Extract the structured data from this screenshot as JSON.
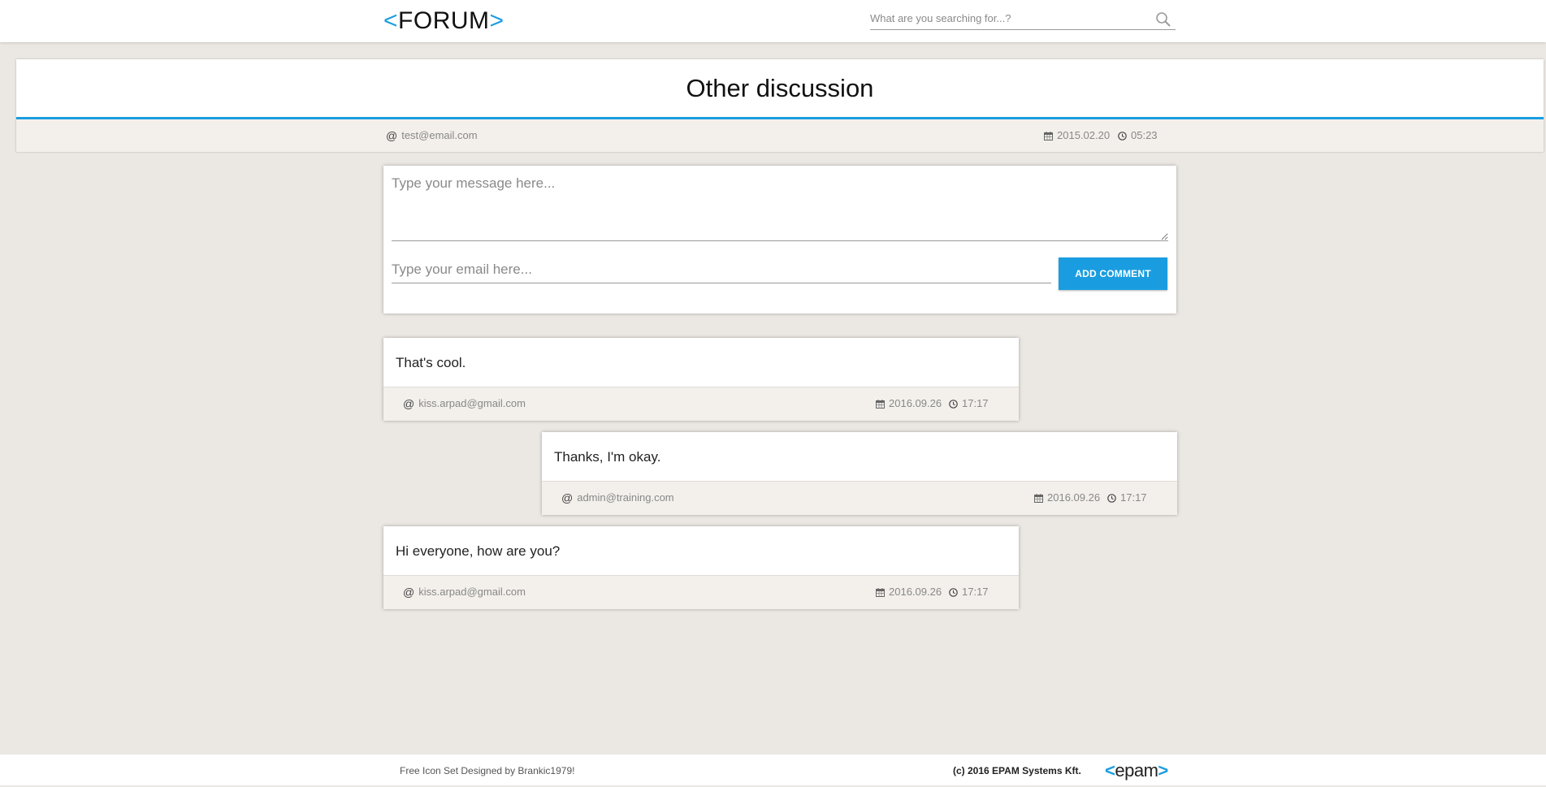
{
  "header": {
    "logo_open": "<",
    "logo_text": "FORUM",
    "logo_close": ">",
    "search_placeholder": "What are you searching for...?"
  },
  "topic": {
    "title": "Other discussion",
    "author": "test@email.com",
    "date": "2015.02.20",
    "time": "05:23"
  },
  "form": {
    "message_placeholder": "Type your message here...",
    "email_placeholder": "Type your email here...",
    "submit_label": "ADD COMMENT"
  },
  "comments": [
    {
      "text": "That's cool.",
      "author": "kiss.arpad@gmail.com",
      "date": "2016.09.26",
      "time": "17:17"
    },
    {
      "text": "Thanks, I'm okay.",
      "author": "admin@training.com",
      "date": "2016.09.26",
      "time": "17:17"
    },
    {
      "text": "Hi everyone, how are you?",
      "author": "kiss.arpad@gmail.com",
      "date": "2016.09.26",
      "time": "17:17"
    }
  ],
  "footer": {
    "credit": "Free Icon Set Designed by Brankic1979!",
    "copyright": "(c) 2016 EPAM Systems Kft.",
    "brand_open": "<",
    "brand": "epam",
    "brand_close": ">"
  },
  "colors": {
    "accent": "#1a9de0",
    "background": "#ebe7e3",
    "meta_bar": "#f3f0ec"
  },
  "icons": {
    "at": "@",
    "calendar": "calendar-icon",
    "clock": "clock-icon",
    "search": "search-icon"
  }
}
